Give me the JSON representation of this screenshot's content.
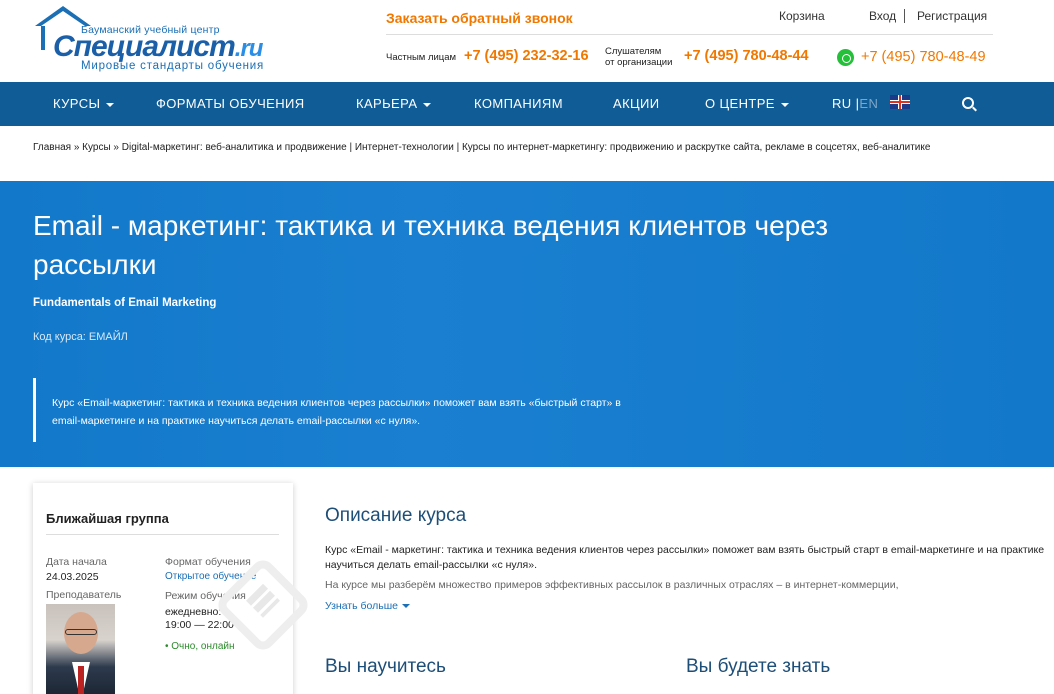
{
  "header": {
    "logo": {
      "small": "Бауманский учебный центр",
      "name": "Специалист",
      "domain": ".ru",
      "slogan": "Мировые стандарты обучения"
    },
    "callback": "Заказать обратный звонок",
    "cart": "Корзина",
    "login": "Вход",
    "register": "Регистрация",
    "private_label": "Частным лицам",
    "private_phone": "+7 (495) 232-32-16",
    "org_label_1": "Слушателям",
    "org_label_2": "от организации",
    "org_phone": "+7 (495) 780-48-44",
    "whatsapp_phone": "+7 (495) 780-48-49"
  },
  "nav": {
    "items": [
      "КУРСЫ",
      "ФОРМАТЫ ОБУЧЕНИЯ",
      "КАРЬЕРА",
      "КОМПАНИЯМ",
      "АКЦИИ",
      "О ЦЕНТРЕ"
    ],
    "lang_ru": "RU",
    "lang_sep": "|",
    "lang_en": "EN"
  },
  "breadcrumb": "Главная » Курсы » Digital-маркетинг: веб-аналитика и продвижение | Интернет-технологии | Курсы по интернет-маркетингу: продвижению и раскрутке сайта, рекламе в соцсетях, веб-аналитике",
  "hero": {
    "title": "Email - маркетинг: тактика и техника ведения клиентов через рассылки",
    "subtitle": "Fundamentals of Email Marketing",
    "code": "Код курса: ЕМАЙЛ",
    "quote": "Курс «Email-маркетинг: тактика и техника ведения клиентов через рассылки» поможет вам взять «быстрый старт» в email-маркетинге и на практике научиться делать email-рассылки «с нуля»."
  },
  "card": {
    "title": "Ближайшая группа",
    "start_label": "Дата начала",
    "start_value": "24.03.2025",
    "teacher_label": "Преподаватель",
    "format_label": "Формат обучения",
    "format_value": "Открытое обучение",
    "mode_label": "Режим обучения",
    "mode_value_1": "ежедневно:",
    "mode_value_2": "19:00 — 22:00",
    "online": "• Очно, онлайн"
  },
  "main": {
    "desc_title": "Описание курса",
    "desc_text": "Курс «Email - маркетинг: тактика и техника ведения клиентов через рассылки» поможет вам взять быстрый старт в email-маркетинге и на практике научиться делать email-рассылки «с нуля».",
    "desc_text2": "На курсе мы разберём множество примеров эффективных рассылок в различных отраслях – в интернет-коммерции,",
    "more": "Узнать больше",
    "learn_title": "Вы научитесь",
    "know_title": "Вы будете знать"
  }
}
